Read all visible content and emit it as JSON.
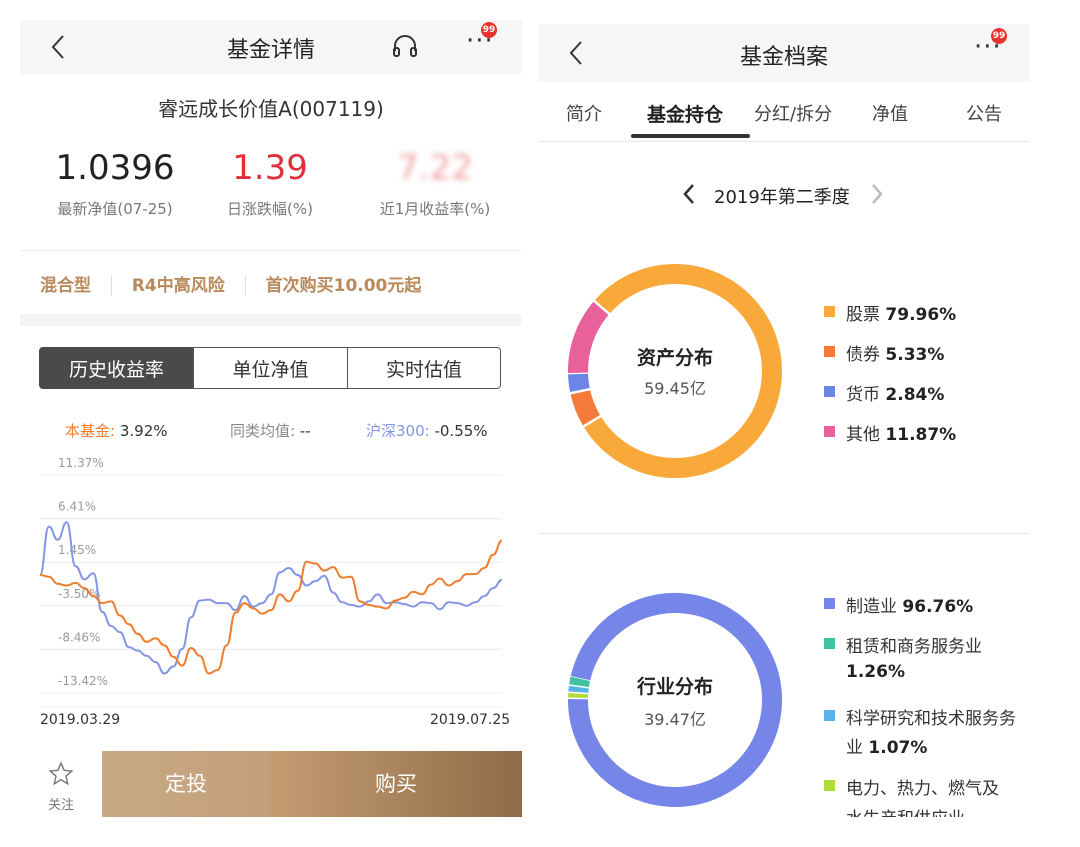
{
  "left": {
    "header": {
      "title": "基金详情",
      "badge": "99"
    },
    "fund_name": "睿远成长价值A(007119)",
    "stats": [
      {
        "value": "1.0396",
        "label": "最新净值(07-25)",
        "color": "#222222"
      },
      {
        "value": "1.39",
        "label": "日涨跌幅(%)",
        "color": "#e0313a"
      },
      {
        "value": "7.22",
        "label": "近1月收益率(%)",
        "color": "#f0a0a0"
      }
    ],
    "tags": [
      "混合型",
      "R4中高风险",
      "首次购买10.00元起"
    ],
    "segments": [
      "历史收益率",
      "单位净值",
      "实时估值"
    ],
    "compare": {
      "fund_label": "本基金:",
      "fund_value": "3.92%",
      "avg_label": "同类均值:",
      "avg_value": "--",
      "index_label": "沪深300:",
      "index_value": "-0.55%"
    },
    "y_ticks": [
      "11.37%",
      "6.41%",
      "1.45%",
      "-3.50%",
      "-8.46%",
      "-13.42%"
    ],
    "x_start": "2019.03.29",
    "x_end": "2019.07.25",
    "bottom": {
      "follow": "关注",
      "fixed": "定投",
      "buy": "购买"
    }
  },
  "right": {
    "header": {
      "title": "基金档案",
      "badge": "99"
    },
    "tabs": [
      "简介",
      "基金持仓",
      "分红/拆分",
      "净值",
      "公告"
    ],
    "quarter": "2019年第二季度",
    "asset": {
      "title": "资产分布",
      "total": "59.45亿",
      "items": [
        {
          "name": "股票",
          "value": "79.96%",
          "pct": 79.96,
          "color": "#f9a83a"
        },
        {
          "name": "债券",
          "value": "5.33%",
          "pct": 5.33,
          "color": "#f47a3a"
        },
        {
          "name": "货币",
          "value": "2.84%",
          "pct": 2.84,
          "color": "#6b86e6"
        },
        {
          "name": "其他",
          "value": "11.87%",
          "pct": 11.87,
          "color": "#e8619a"
        }
      ]
    },
    "industry": {
      "title": "行业分布",
      "total": "39.47亿",
      "items": [
        {
          "name": "制造业",
          "value": "96.76%",
          "pct": 96.76,
          "color": "#7586e8"
        },
        {
          "name": "租赁和商务服务业",
          "value": "1.26%",
          "pct": 1.26,
          "color": "#41c2a0"
        },
        {
          "name": "科学研究和技术服务业",
          "value": "1.07%",
          "pct": 1.07,
          "color": "#5ab3e6"
        },
        {
          "name": "电力、热力、燃气及水生产和供应业",
          "value": "",
          "pct": 0.91,
          "color": "#b0dc3c"
        }
      ],
      "legend_lines": [
        {
          "a": "制造业",
          "b": "96.76%"
        },
        {
          "a": "租赁和商务服务业",
          "b": ""
        },
        {
          "a": "",
          "b": "1.26%"
        },
        {
          "a": "科学研究和技术服务务",
          "b": ""
        },
        {
          "a": "业",
          "b": "1.07%"
        },
        {
          "a": "电力、热力、燃气及",
          "b": ""
        },
        {
          "a": "水生产和供应业",
          "b": ""
        }
      ]
    }
  },
  "chart_data": {
    "type": "line",
    "x": [
      "2019.03.29",
      "2019.07.25"
    ],
    "ylim": [
      -13.42,
      11.37
    ],
    "y_ticks": [
      11.37,
      6.41,
      1.45,
      -3.5,
      -8.46,
      -13.42
    ],
    "series": [
      {
        "name": "本基金",
        "color": "#f07d2e",
        "values": [
          0.0,
          -0.2,
          -1.0,
          -1.2,
          -0.9,
          -1.5,
          -2.4,
          -3.2,
          -3.0,
          -4.6,
          -5.6,
          -6.7,
          -7.6,
          -7.2,
          -8.0,
          -9.3,
          -10.3,
          -8.3,
          -9.2,
          -11.2,
          -10.8,
          -8.0,
          -4.3,
          -3.2,
          -3.8,
          -4.4,
          -4.0,
          -2.2,
          -3.0,
          -1.8,
          1.5,
          1.3,
          0.5,
          0.9,
          -0.3,
          -0.2,
          -3.0,
          -3.4,
          -3.6,
          -3.8,
          -2.9,
          -2.6,
          -1.9,
          -2.2,
          -1.1,
          -0.4,
          -1.2,
          -0.7,
          0.1,
          0.1,
          0.8,
          2.3,
          3.92
        ]
      },
      {
        "name": "沪深300",
        "color": "#8496e3",
        "values": [
          0.0,
          5.5,
          4.0,
          6.0,
          1.0,
          -0.5,
          0.2,
          -4.2,
          -5.8,
          -6.5,
          -8.2,
          -8.6,
          -9.2,
          -9.9,
          -11.2,
          -10.4,
          -8.4,
          -4.8,
          -2.9,
          -2.8,
          -3.2,
          -3.2,
          -4.0,
          -2.4,
          -3.6,
          -3.2,
          -2.2,
          0.3,
          0.8,
          0.0,
          -1.2,
          -0.7,
          -0.1,
          -2.0,
          -3.1,
          -3.4,
          -3.6,
          -3.0,
          -2.2,
          -3.2,
          -3.1,
          -3.3,
          -3.6,
          -3.1,
          -3.2,
          -3.9,
          -3.1,
          -3.2,
          -3.5,
          -3.1,
          -2.4,
          -1.5,
          -0.55
        ]
      }
    ]
  }
}
